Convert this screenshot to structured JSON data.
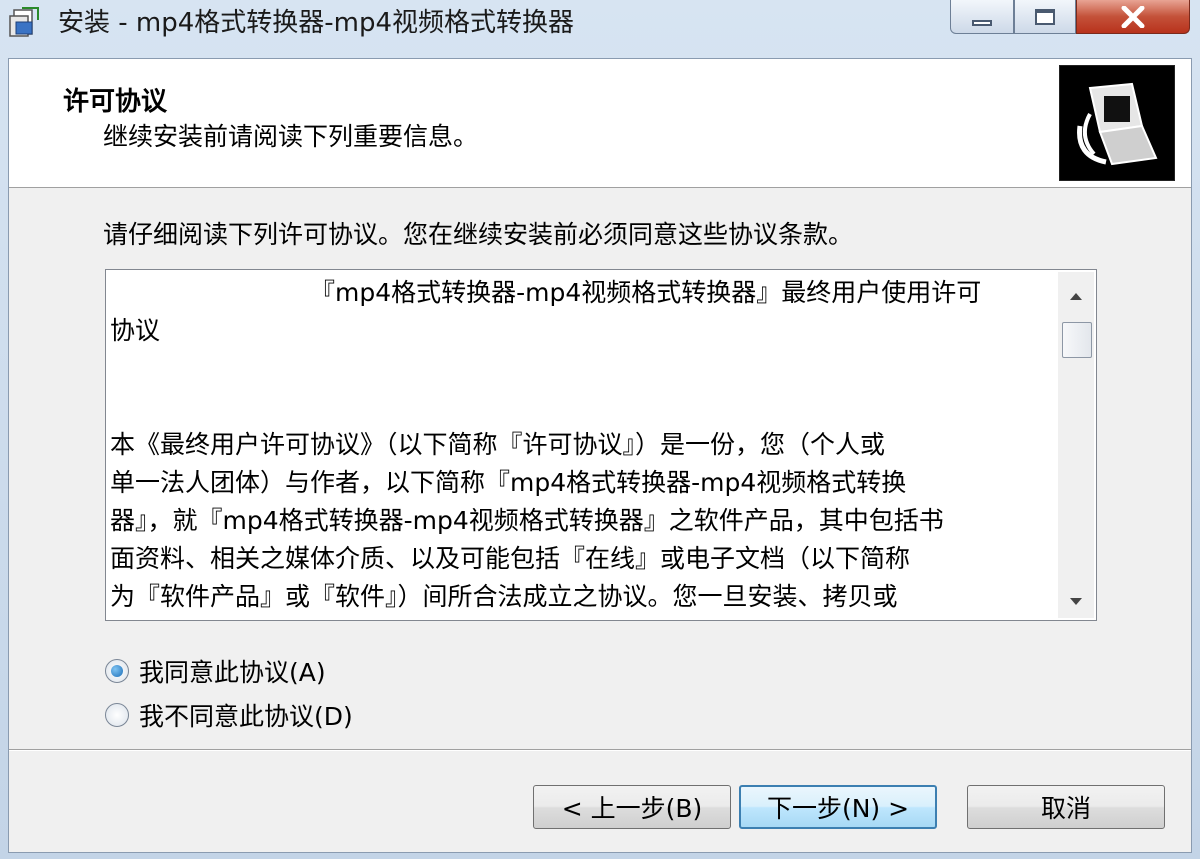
{
  "window": {
    "title": "安装 - mp4格式转换器-mp4视频格式转换器"
  },
  "header": {
    "title": "许可协议",
    "subtitle": "继续安装前请阅读下列重要信息。"
  },
  "instruction": "请仔细阅读下列许可协议。您在继续安装前必须同意这些协议条款。",
  "license": {
    "title_line1": "『mp4格式转换器-mp4视频格式转换器』最终用户使用许可",
    "title_line2": "协议",
    "body_lines": [
      "本《最终用户许可协议》（以下简称『许可协议』）是一份，您（个人或",
      "单一法人团体）与作者，以下简称『mp4格式转换器-mp4视频格式转换",
      "器』，就『mp4格式转换器-mp4视频格式转换器』之软件产品，其中包括书",
      "面资料、相关之媒体介质、以及可能包括『在线』或电子文档（以下简称",
      "为『软件产品』或『软件』）间所合法成立之协议。您一旦安装、拷贝或"
    ]
  },
  "options": {
    "agree": {
      "label": "我同意此协议(A)",
      "checked": true
    },
    "disagree": {
      "label": "我不同意此协议(D)",
      "checked": false
    }
  },
  "buttons": {
    "back": "< 上一步(B)",
    "next": "下一步(N) >",
    "cancel": "取消"
  }
}
